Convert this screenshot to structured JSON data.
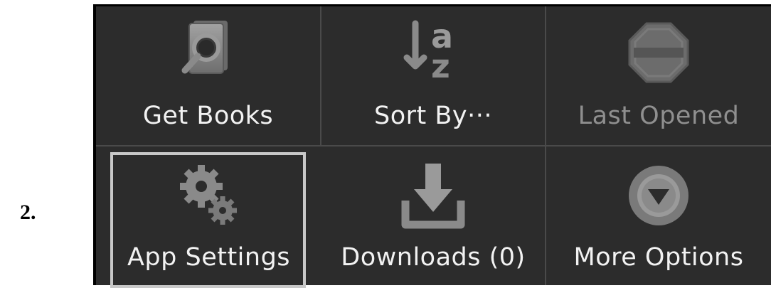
{
  "step_number": "2.",
  "menu": {
    "items": [
      {
        "label": "Get Books",
        "icon": "book-search-icon"
      },
      {
        "label": "Sort By···",
        "icon": "sort-az-icon"
      },
      {
        "label": "Last Opened",
        "icon": "last-opened-icon",
        "state": "disabled"
      },
      {
        "label": "App Settings",
        "icon": "gears-icon",
        "state": "selected"
      },
      {
        "label": "Downloads (0)",
        "icon": "download-icon"
      },
      {
        "label": "More Options",
        "icon": "more-options-icon"
      }
    ]
  },
  "colors": {
    "background": "#2c2c2c",
    "icon_gray": "#8a8a8a",
    "label": "#f2f2f2",
    "disabled_label": "#8f8f8f",
    "focus_frame": "#c8c8c8"
  }
}
